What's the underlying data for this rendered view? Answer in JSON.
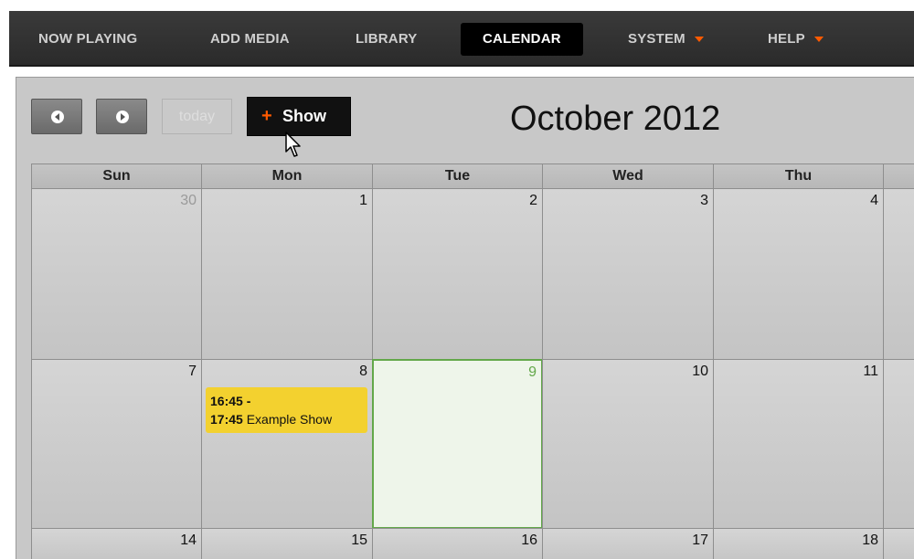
{
  "nav": {
    "items": [
      {
        "label": "NOW PLAYING"
      },
      {
        "label": "ADD MEDIA"
      },
      {
        "label": "LIBRARY"
      },
      {
        "label": "CALENDAR"
      },
      {
        "label": "SYSTEM"
      },
      {
        "label": "HELP"
      }
    ],
    "active": "CALENDAR"
  },
  "toolbar": {
    "prev_icon": "chevron-left-circle-icon",
    "next_icon": "chevron-right-circle-icon",
    "today_label": "today",
    "add_show_label": "Show",
    "add_show_icon": "plus-icon"
  },
  "calendar": {
    "title": "October 2012",
    "weekdays": [
      "Sun",
      "Mon",
      "Tue",
      "Wed",
      "Thu"
    ],
    "weeks": [
      [
        "30",
        "1",
        "2",
        "3",
        "4"
      ],
      [
        "7",
        "8",
        "9",
        "10",
        "11"
      ],
      [
        "14",
        "15",
        "16",
        "17",
        "18"
      ]
    ],
    "today": "9",
    "event": {
      "start": "16:45 -",
      "end": "17:45",
      "title": "Example Show"
    }
  },
  "colors": {
    "accent": "#ff5a00",
    "today_border": "#63a84a",
    "today_bg": "#eef5ea",
    "event_bg": "#f3d12f"
  }
}
